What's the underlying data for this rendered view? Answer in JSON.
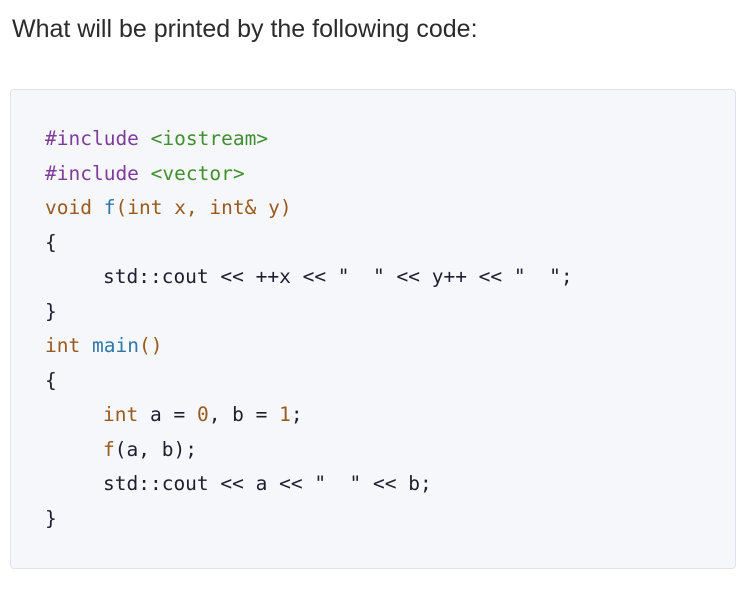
{
  "question": {
    "text": "What will be printed by the following code:"
  },
  "code": {
    "lines": [
      {
        "tokens": [
          {
            "t": "#include",
            "k": "preproc"
          },
          {
            "t": " ",
            "k": "plain"
          },
          {
            "t": "<iostream>",
            "k": "header"
          }
        ]
      },
      {
        "tokens": [
          {
            "t": "#include",
            "k": "preproc"
          },
          {
            "t": " ",
            "k": "plain"
          },
          {
            "t": "<vector>",
            "k": "header"
          }
        ]
      },
      {
        "tokens": [
          {
            "t": "void",
            "k": "keyword"
          },
          {
            "t": " ",
            "k": "plain"
          },
          {
            "t": "f",
            "k": "func-name"
          },
          {
            "t": "(",
            "k": "keyword"
          },
          {
            "t": "int",
            "k": "keyword"
          },
          {
            "t": " x, ",
            "k": "keyword"
          },
          {
            "t": "int&",
            "k": "keyword"
          },
          {
            "t": " y)",
            "k": "keyword"
          }
        ]
      },
      {
        "tokens": [
          {
            "t": "{",
            "k": "plain"
          }
        ]
      },
      {
        "indent": true,
        "tokens": [
          {
            "t": "std::cout << ++x << \"  \" << y++ << \"  \";",
            "k": "plain"
          }
        ]
      },
      {
        "tokens": [
          {
            "t": "}",
            "k": "plain"
          }
        ]
      },
      {
        "tokens": [
          {
            "t": "int",
            "k": "keyword"
          },
          {
            "t": " ",
            "k": "plain"
          },
          {
            "t": "main",
            "k": "func-name"
          },
          {
            "t": "()",
            "k": "keyword"
          }
        ]
      },
      {
        "tokens": [
          {
            "t": "{",
            "k": "plain"
          }
        ]
      },
      {
        "indent": true,
        "tokens": [
          {
            "t": "int",
            "k": "keyword"
          },
          {
            "t": " a = ",
            "k": "plain"
          },
          {
            "t": "0",
            "k": "number"
          },
          {
            "t": ", b = ",
            "k": "plain"
          },
          {
            "t": "1",
            "k": "number"
          },
          {
            "t": ";",
            "k": "plain"
          }
        ]
      },
      {
        "indent": true,
        "tokens": [
          {
            "t": "f",
            "k": "keyword"
          },
          {
            "t": "(a, b);",
            "k": "plain"
          }
        ]
      },
      {
        "indent": true,
        "tokens": [
          {
            "t": "std::cout << a << \"  \" << b;",
            "k": "plain"
          }
        ]
      },
      {
        "tokens": [
          {
            "t": "}",
            "k": "plain"
          }
        ]
      }
    ]
  },
  "colors": {
    "keyword": "#9a5a1d",
    "preproc": "#7d3c98",
    "header": "#3f8f2e",
    "func_name": "#2e78a8",
    "plain": "#1e1e2e",
    "panel_background": "#f6f7fb"
  }
}
